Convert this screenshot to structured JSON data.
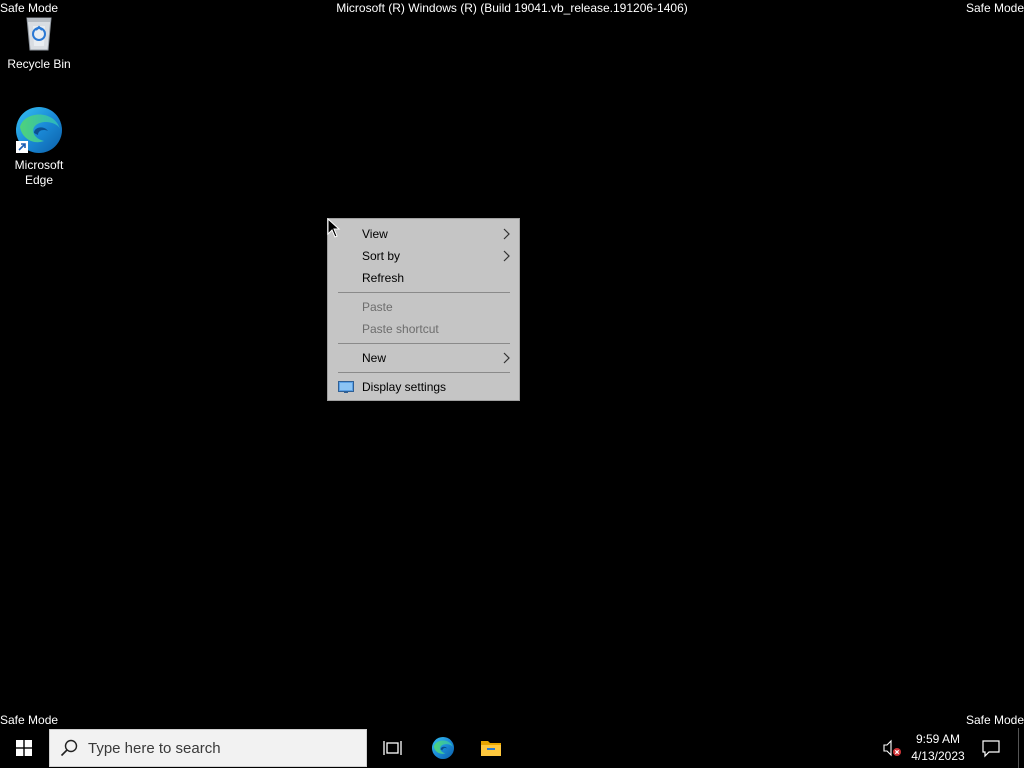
{
  "overlay": {
    "top_left": "Safe Mode",
    "top_right": "Safe Mode",
    "bottom_left": "Safe Mode",
    "bottom_right": "Safe Mode",
    "build_title": "Microsoft (R) Windows (R) (Build 19041.vb_release.191206-1406)"
  },
  "desktop": {
    "icons": [
      {
        "label": "Recycle Bin",
        "icon": "recycle-bin-icon"
      },
      {
        "label_line1": "Microsoft",
        "label_line2": "Edge",
        "icon": "edge-icon"
      }
    ]
  },
  "context_menu": {
    "items": [
      {
        "label": "View",
        "has_submenu": true,
        "enabled": true
      },
      {
        "label": "Sort by",
        "has_submenu": true,
        "enabled": true
      },
      {
        "label": "Refresh",
        "has_submenu": false,
        "enabled": true
      },
      {
        "label": "Paste",
        "has_submenu": false,
        "enabled": false
      },
      {
        "label": "Paste shortcut",
        "has_submenu": false,
        "enabled": false
      },
      {
        "label": "New",
        "has_submenu": true,
        "enabled": true
      },
      {
        "label": "Display settings",
        "has_submenu": false,
        "enabled": true,
        "icon": "display-icon"
      }
    ]
  },
  "taskbar": {
    "search_placeholder": "Type here to search",
    "time": "9:59 AM",
    "date": "4/13/2023",
    "pinned": [
      "task-view-icon",
      "edge-icon",
      "file-explorer-icon"
    ],
    "tray": [
      "speaker-muted-icon",
      "notification-icon"
    ]
  },
  "colors": {
    "background": "#000000",
    "menu_bg": "#c5c5c5",
    "disabled_text": "#6d6d6d",
    "search_bg": "#f2f2f2",
    "start_blue": "#ffffff"
  }
}
